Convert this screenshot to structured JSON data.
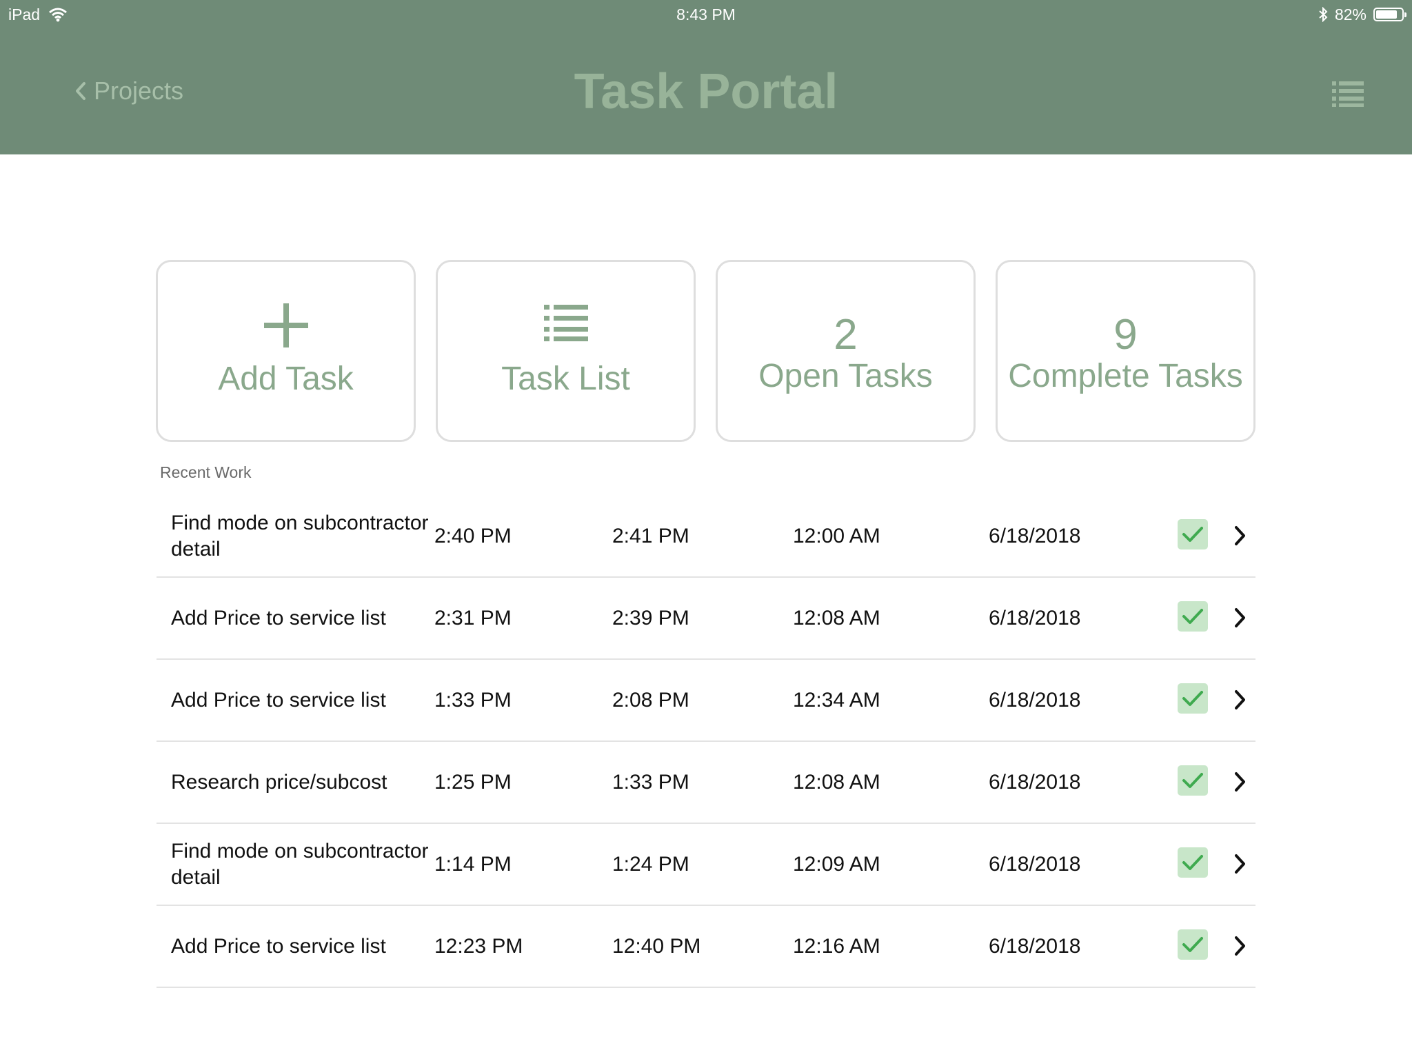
{
  "status_bar": {
    "device": "iPad",
    "time": "8:43 PM",
    "battery": "82%",
    "battery_level": 0.82,
    "icons": [
      "wifi-icon",
      "bluetooth-icon",
      "battery-icon"
    ]
  },
  "header": {
    "back_label": "Projects",
    "title": "Task Portal",
    "menu_icon": "list-icon"
  },
  "tiles": {
    "add_task": {
      "label": "Add Task",
      "icon": "plus-icon"
    },
    "task_list": {
      "label": "Task List",
      "icon": "list-icon"
    },
    "open_tasks": {
      "count": "2",
      "label": "Open Tasks"
    },
    "complete_tasks": {
      "count": "9",
      "label": "Complete Tasks"
    }
  },
  "recent": {
    "label": "Recent Work",
    "rows": [
      {
        "name": "Find mode on subcontractor detail",
        "start": "2:40 PM",
        "end": "2:41 PM",
        "duration": "12:00 AM",
        "date": "6/18/2018",
        "complete": true
      },
      {
        "name": "Add Price to service list",
        "start": "2:31 PM",
        "end": "2:39 PM",
        "duration": "12:08 AM",
        "date": "6/18/2018",
        "complete": true
      },
      {
        "name": "Add Price to service list",
        "start": "1:33 PM",
        "end": "2:08 PM",
        "duration": "12:34 AM",
        "date": "6/18/2018",
        "complete": true
      },
      {
        "name": "Research price/subcost",
        "start": "1:25 PM",
        "end": "1:33 PM",
        "duration": "12:08 AM",
        "date": "6/18/2018",
        "complete": true
      },
      {
        "name": "Find mode on subcontractor detail",
        "start": "1:14 PM",
        "end": "1:24 PM",
        "duration": "12:09 AM",
        "date": "6/18/2018",
        "complete": true
      },
      {
        "name": "Add Price to service list",
        "start": "12:23 PM",
        "end": "12:40 PM",
        "duration": "12:16 AM",
        "date": "6/18/2018",
        "complete": true
      }
    ]
  },
  "colors": {
    "header_bg": "#6f8b77",
    "accent": "#8aa88c",
    "check_bg": "#c8e6c9",
    "check_mark": "#3faa4f"
  }
}
